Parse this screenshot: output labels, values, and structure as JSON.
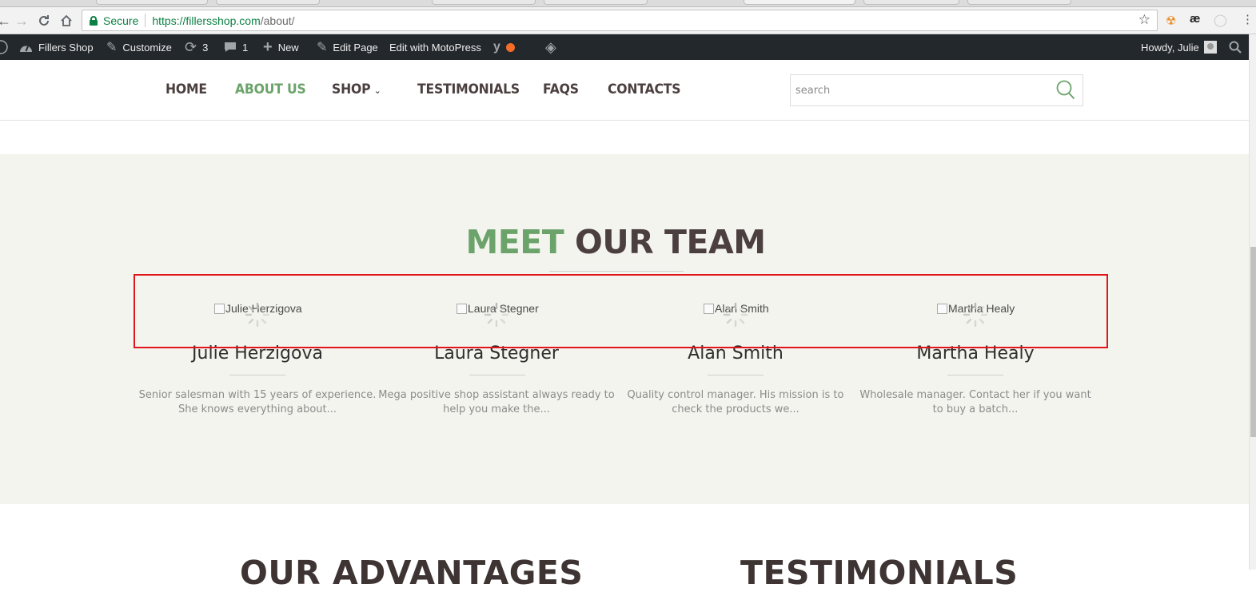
{
  "browser": {
    "secure_label": "Secure",
    "url_host": "https://fillersshop.com",
    "url_path": "/about/",
    "star_icon": "star-icon"
  },
  "adminbar": {
    "site_name": "Fillers Shop",
    "customize": "Customize",
    "updates_count": "3",
    "comments_count": "1",
    "new_label": "New",
    "edit_page": "Edit Page",
    "edit_motopress": "Edit with MotoPress",
    "howdy": "Howdy, Julie"
  },
  "nav": {
    "items": [
      {
        "label": "HOME"
      },
      {
        "label": "ABOUT US",
        "active": true
      },
      {
        "label": "SHOP"
      },
      {
        "label": "TESTIMONIALS"
      },
      {
        "label": "FAQS"
      },
      {
        "label": "CONTACTS"
      }
    ],
    "search_placeholder": "search"
  },
  "team": {
    "heading_green": "MEET",
    "heading_dark": "OUR TEAM",
    "members": [
      {
        "alt": "Julie Herzigova",
        "name": "Julie Herzigova",
        "desc": "Senior salesman with 15 years of experience. She knows everything about..."
      },
      {
        "alt": "Laura Stegner",
        "name": "Laura Stegner",
        "desc": "Mega positive shop assistant always ready to help you make the..."
      },
      {
        "alt": "Alan Smith",
        "name": "Alan Smith",
        "desc": "Quality control manager. His mission is to check the products we..."
      },
      {
        "alt": "Martha Healy",
        "name": "Martha Healy",
        "desc": "Wholesale manager. Contact her if you want to buy a batch..."
      }
    ]
  },
  "below": {
    "left_heading": "OUR ADVANTAGES",
    "right_heading": "TESTIMONIALS"
  },
  "colors": {
    "accent_green": "#6ba36b",
    "dark_text": "#4b3f3f",
    "section_bg": "#f4f4ee",
    "highlight_red": "#e2141b",
    "adminbar_bg": "#23282d"
  }
}
